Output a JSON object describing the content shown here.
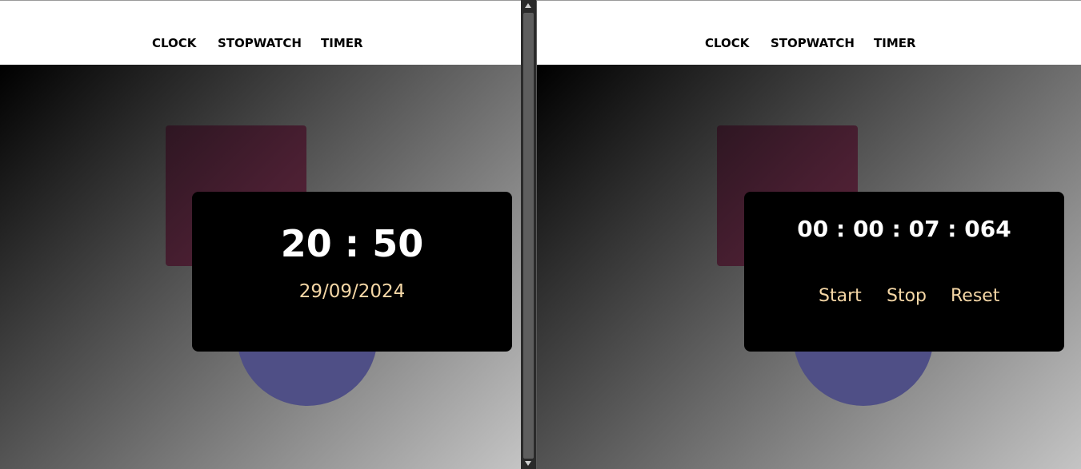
{
  "left_view": {
    "nav": {
      "clock": "CLOCK",
      "stopwatch": "STOPWATCH",
      "timer": "TIMER"
    },
    "clock": {
      "time": "20 : 50",
      "date": "29/09/2024"
    }
  },
  "right_view": {
    "nav": {
      "clock": "CLOCK",
      "stopwatch": "STOPWATCH",
      "timer": "TIMER"
    },
    "stopwatch": {
      "time": "00 : 00 : 07 : 064",
      "start_label": "Start",
      "stop_label": "Stop",
      "reset_label": "Reset"
    }
  },
  "colors": {
    "accent_text": "#f5d7a6",
    "card_bg": "#000000",
    "square": "#4a1f32",
    "circle": "#4f4f86"
  }
}
